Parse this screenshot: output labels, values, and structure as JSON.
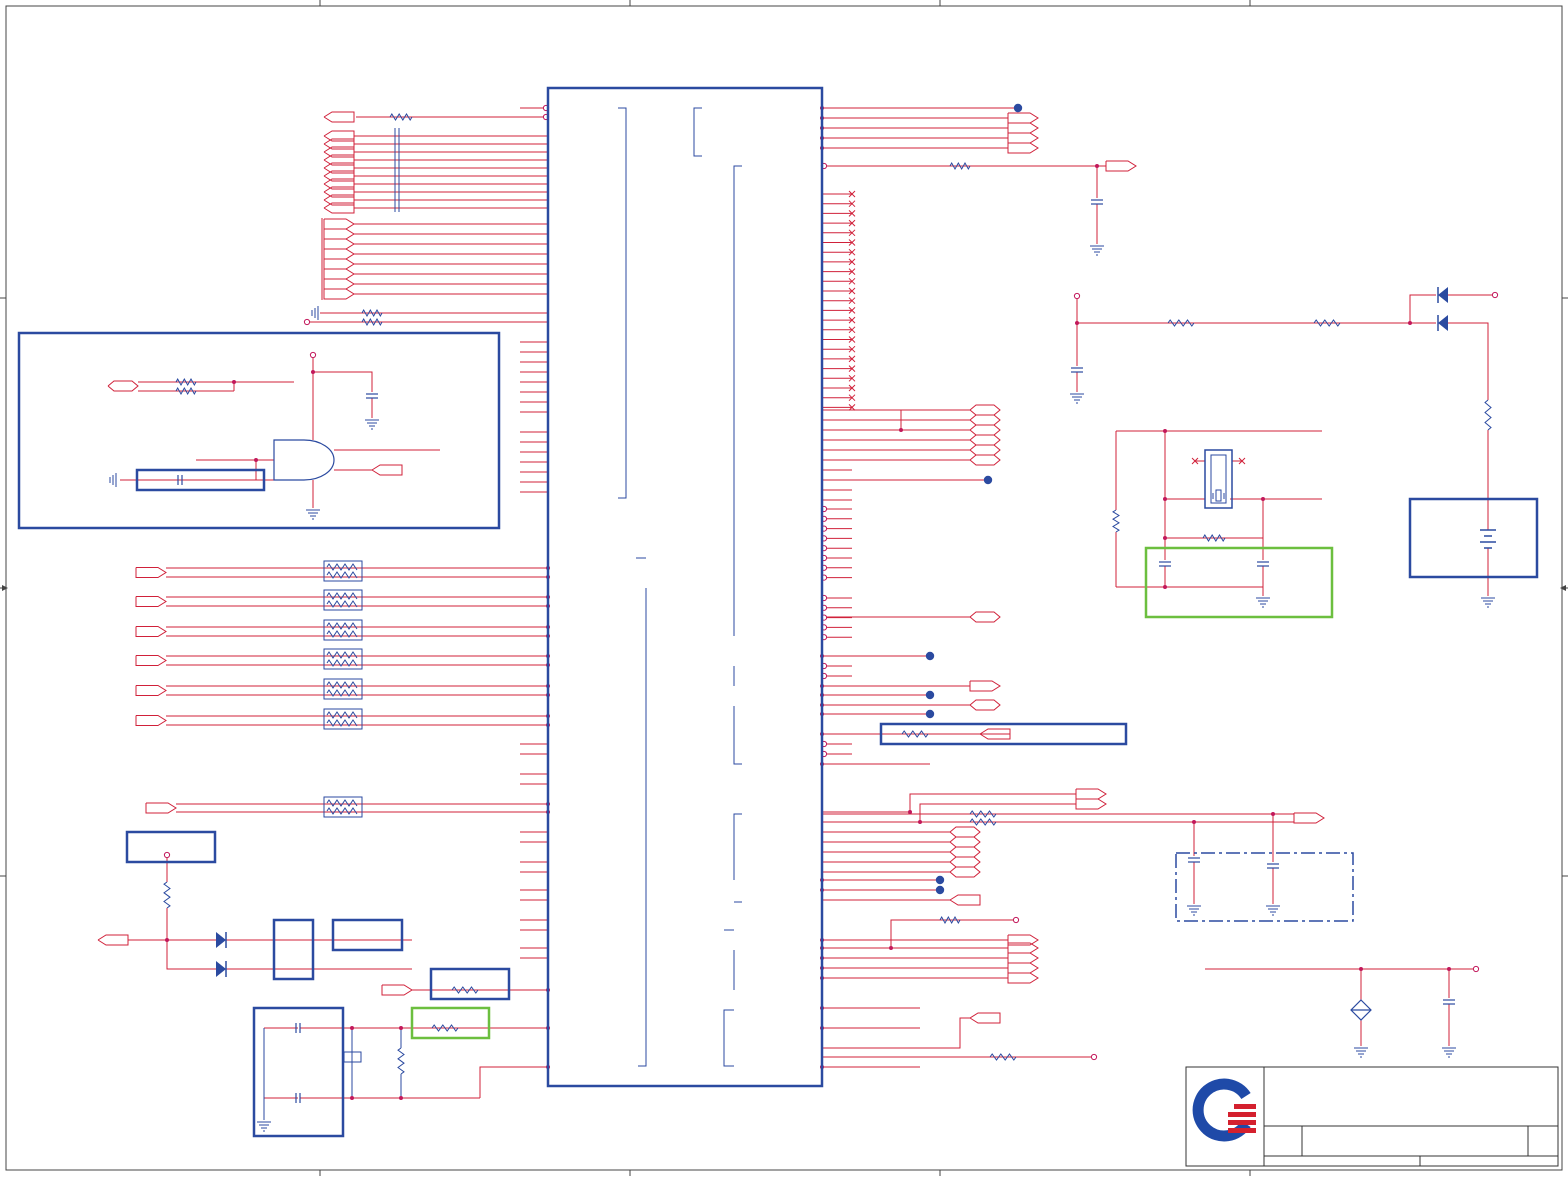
{
  "sheet": {
    "type": "electrical schematic sheet",
    "text_labels": [],
    "colors": {
      "wire": "#d0213a",
      "outline": "#2b4aa0",
      "highlight_green": "#6cbf3f",
      "junction": "#c2185b",
      "background": "#ffffff",
      "frame": "#444444"
    }
  },
  "title_block": {
    "logo_icon": "company-logo-icon"
  }
}
